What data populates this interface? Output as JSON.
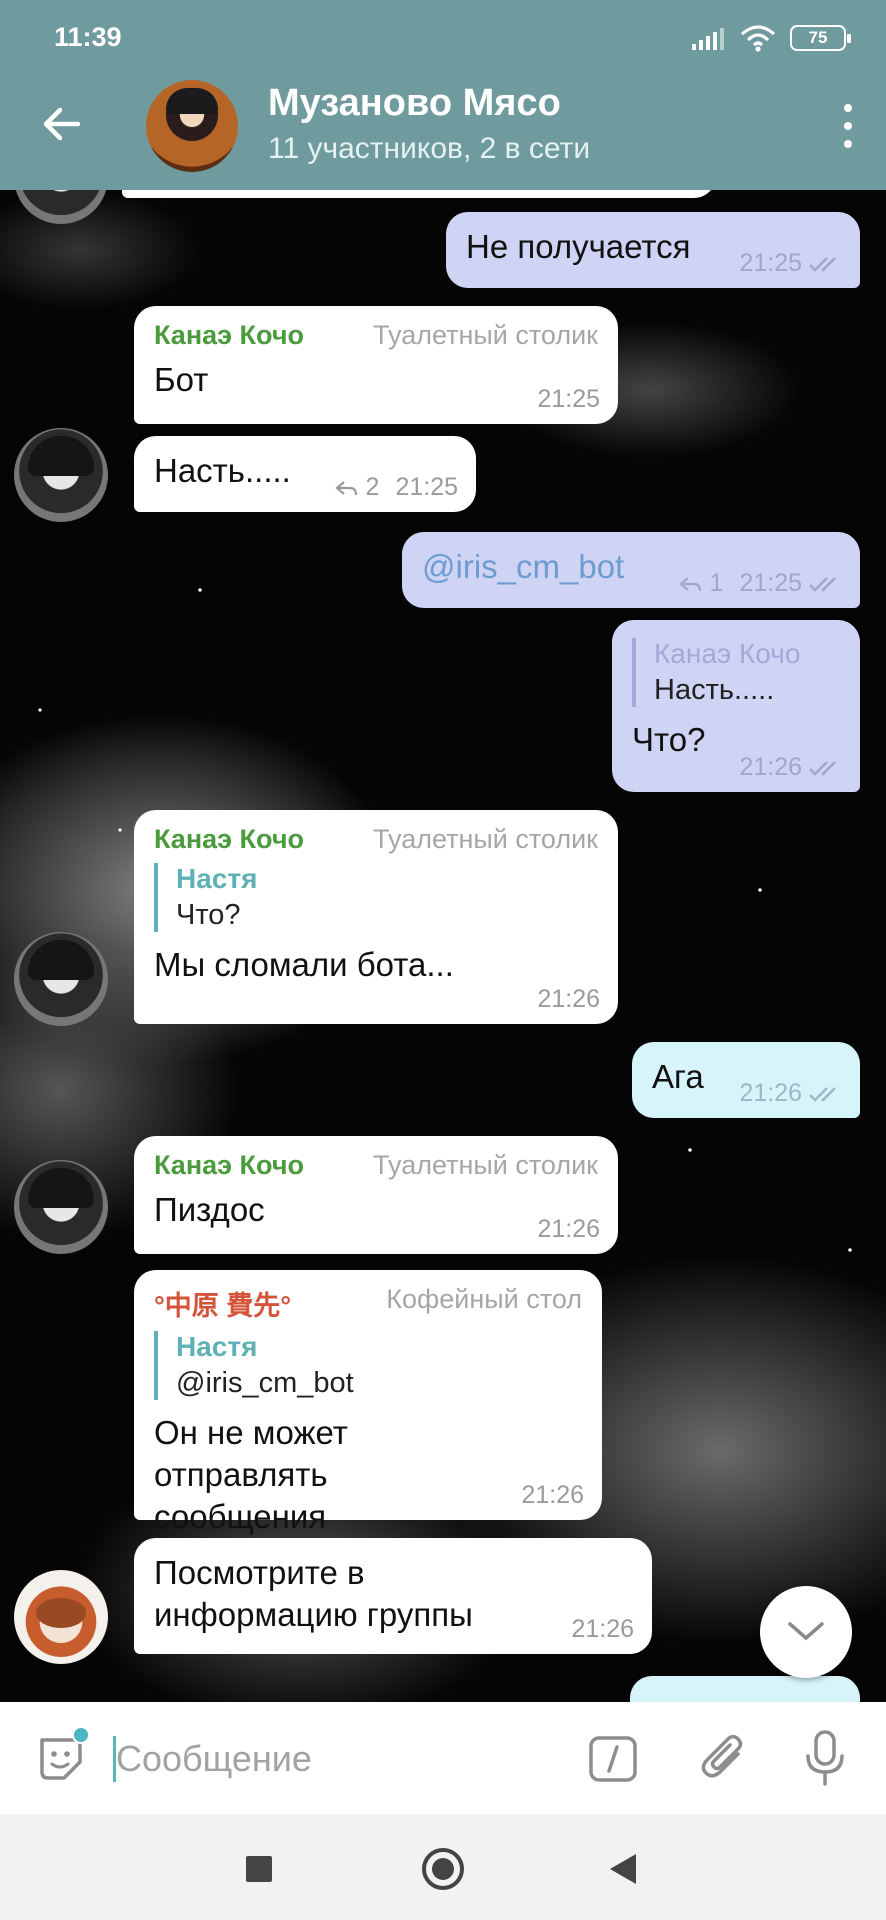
{
  "status_bar": {
    "time": "11:39",
    "battery": "75"
  },
  "header": {
    "title": "Музаново Мясо",
    "subtitle": "11 участников, 2 в сети"
  },
  "messages": [
    {
      "id": "m1",
      "direction": "out",
      "text": "Не получается",
      "time": "21:25",
      "read": true
    },
    {
      "id": "m2",
      "direction": "in",
      "sender": "Канаэ Кочо",
      "role": "Туалетный столик",
      "text": "Бот",
      "time": "21:25"
    },
    {
      "id": "m3",
      "direction": "in",
      "text": "Насть.....",
      "time": "21:25",
      "replies": "2"
    },
    {
      "id": "m4",
      "direction": "out",
      "text": "@iris_cm_bot",
      "time": "21:25",
      "replies": "1",
      "read": true
    },
    {
      "id": "m5",
      "direction": "out",
      "reply_to": {
        "name": "Канаэ Кочо",
        "text": "Насть....."
      },
      "text": "Что?",
      "time": "21:26",
      "read": true
    },
    {
      "id": "m6",
      "direction": "in",
      "sender": "Канаэ Кочо",
      "role": "Туалетный столик",
      "reply_to": {
        "name": "Настя",
        "text": "Что?"
      },
      "text": "Мы сломали бота...",
      "time": "21:26"
    },
    {
      "id": "m7",
      "direction": "out",
      "text": "Ага",
      "time": "21:26",
      "read": true
    },
    {
      "id": "m8",
      "direction": "in",
      "sender": "Канаэ Кочо",
      "role": "Туалетный столик",
      "text": "Пиздос",
      "time": "21:26"
    },
    {
      "id": "m9",
      "direction": "in",
      "sender": "°中原 費先°",
      "role": "Кофейный стол",
      "reply_to": {
        "name": "Настя",
        "text": "@iris_cm_bot"
      },
      "text": "Он не может отправлять сообщения",
      "time": "21:26"
    },
    {
      "id": "m10",
      "direction": "in",
      "text": "Посмотрите в информацию группы",
      "time": "21:26"
    }
  ],
  "composer": {
    "placeholder": "Сообщение"
  },
  "colors": {
    "header": "#6f9a9e",
    "sender_green": "#4a9b3c",
    "sender_red": "#d4543a",
    "reply_accent": "#5fb1b5",
    "outgoing": "#cfd3f4",
    "outgoing_cyan": "#d8f4fb"
  },
  "icons": [
    "back-arrow-icon",
    "more-vert-icon",
    "reply-count-icon",
    "double-check-icon",
    "chevron-down-icon",
    "sticker-icon",
    "slash-command-icon",
    "paperclip-icon",
    "microphone-icon"
  ]
}
